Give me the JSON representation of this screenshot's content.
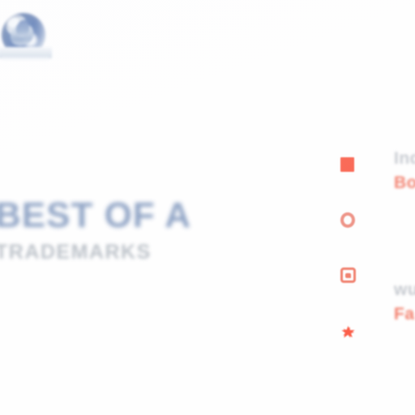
{
  "page": {
    "background_color": "#fefefe",
    "render_quality": "blurred-low-resolution"
  },
  "brand": {
    "logo_name": "company-emblem-logo",
    "logo_colors": [
      "#2f57a0",
      "#5c7cb4",
      "#cfdae9",
      "#d9e2ec"
    ]
  },
  "headline_block": {
    "title": "BEST OF A",
    "title_color": "#5d7bab",
    "subtitle": "TRADEMARKS",
    "subtitle_color": "#9aa3ad"
  },
  "features": {
    "accent_red": "#f8341a",
    "accent_salmon": "#e8705f",
    "label_grey": "#b4b9c1",
    "items": [
      {
        "icon": "square-icon",
        "icon_color": "#f8341a",
        "label_top": "Indu",
        "label_bottom": "Bo"
      },
      {
        "icon": "ring-icon",
        "icon_color": "#e8705f",
        "label_top": "",
        "label_bottom": ""
      },
      {
        "icon": "chat-bubble-square-icon",
        "icon_color": "#ec5a42",
        "label_top": "wu",
        "label_bottom": "Fa"
      },
      {
        "icon": "star-burst-icon",
        "icon_color": "#fa2f14",
        "label_top": "",
        "label_bottom": ""
      }
    ]
  }
}
